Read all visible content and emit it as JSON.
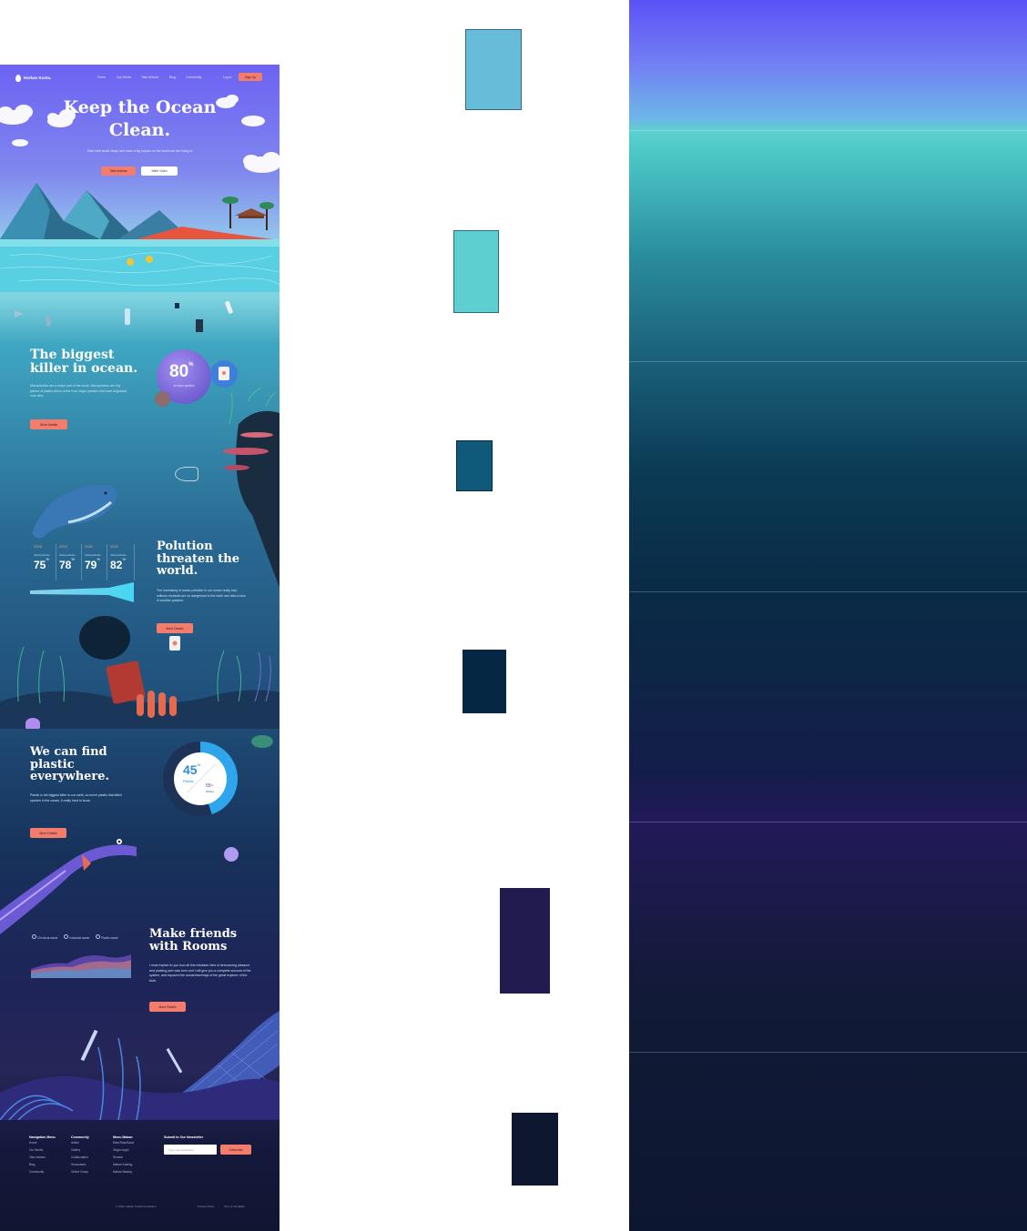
{
  "brand": {
    "name": "Harkan Kusta."
  },
  "nav": {
    "items": [
      "Home",
      "Our Works",
      "Take Actions",
      "Blog",
      "Community"
    ],
    "login": "Log In",
    "signup": "Sign Up"
  },
  "hero": {
    "title_line1": "Keep the Ocean",
    "title_line2": "Clean.",
    "subtitle": "Start with small steps and have a big impact on the world we are living in",
    "cta_primary": "Take Actions",
    "cta_secondary": "Wath Video"
  },
  "section_killer": {
    "title_line1": "The biggest",
    "title_line2": "killer in ocean.",
    "text": "Microplastics are a major part of the issue. Microplastics are tiny pieces of plastic which come from larger plastics that have degraded over time.",
    "button": "More Details",
    "stat_value": "80",
    "stat_unit": "%",
    "stat_label": "of micro plastics"
  },
  "section_pollution": {
    "years": [
      {
        "year": "2018",
        "label": "Global pollution",
        "value": "75",
        "unit": "%"
      },
      {
        "year": "2019",
        "label": "Global pollution",
        "value": "78",
        "unit": "%"
      },
      {
        "year": "2020",
        "label": "Global pollution",
        "value": "79",
        "unit": "%"
      },
      {
        "year": "2021",
        "label": "Global pollution",
        "value": "82",
        "unit": "%"
      }
    ],
    "title_line1": "Polution",
    "title_line2": "threaten the",
    "title_line3": "world.",
    "text": "The increasing of ocean pollution in our ocean really bad, millions of plastic are so dangerous to the earth and also a loss of another polution.",
    "button": "More Details"
  },
  "section_plastic": {
    "title_line1": "We can find",
    "title_line2": "plastic",
    "title_line3": "everywhere.",
    "text": "Plastic is the biggest killer in our earth, so much plastic that killed species in the ocean, it really hard to know.",
    "button": "More Details",
    "donut_value": "45",
    "donut_unit": "%",
    "donut_label": "Plastic",
    "donut_other_value": "55",
    "donut_other_unit": "%",
    "donut_other_label": "Others"
  },
  "section_friends": {
    "legend": [
      "Chemical waste",
      "Industrial waste",
      "Plastic waste"
    ],
    "title_line1": "Make friends",
    "title_line2": "with Rooms",
    "text": "I must explain to you how all this mistaken idea of denouncing pleasure and praising pain was born and I will give you a complete account of the system, and expound the actual teachings of the great explorer of the truth.",
    "button": "More Details"
  },
  "footer": {
    "col1": {
      "title": "Navigation Menu",
      "items": [
        "Home",
        "Our Works",
        "Take Actions",
        "Blog",
        "Community"
      ]
    },
    "col2": {
      "title": "Community",
      "items": [
        "Artikel",
        "Gallery",
        "Collaboration",
        "Showcases",
        "Online Group"
      ]
    },
    "col3": {
      "title": "Menu Makan",
      "items": [
        "Rata Rata Barat",
        "Ongol-ongol",
        "Semwit",
        "Mahan Kusting",
        "Mahan Masing"
      ]
    },
    "newsletter": {
      "title": "Submit to Our Newsletter",
      "placeholder": "Type your email here",
      "button": "Subscribe"
    },
    "copyright": "© 2021 Harkan Kusta Foundation",
    "links": [
      "Privacy Policy",
      "Term & Condition"
    ]
  },
  "colors": {
    "coral": "#f47c6b",
    "swatch_1": "#66bcd9",
    "swatch_2": "#5ecfd1",
    "swatch_3": "#0f5a7a",
    "swatch_4": "#052744",
    "swatch_5": "#211b4f",
    "swatch_6": "#0e1730"
  }
}
